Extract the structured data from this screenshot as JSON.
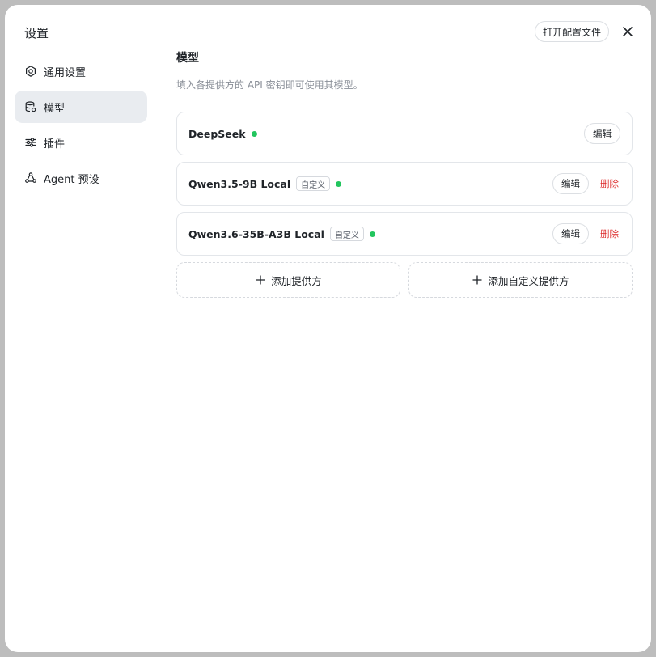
{
  "window": {
    "title": "设置",
    "open_config_label": "打开配置文件"
  },
  "sidebar": {
    "items": [
      {
        "label": "通用设置",
        "icon": "gear-icon",
        "active": false
      },
      {
        "label": "模型",
        "icon": "database-icon",
        "active": true
      },
      {
        "label": "插件",
        "icon": "sliders-icon",
        "active": false
      },
      {
        "label": "Agent 预设",
        "icon": "agent-icon",
        "active": false
      }
    ]
  },
  "main": {
    "title": "模型",
    "description": "填入各提供方的 API 密钥即可使用其模型。",
    "providers": [
      {
        "name": "DeepSeek",
        "custom": false,
        "edit_label": "编辑"
      },
      {
        "name": "Qwen3.5-9B Local",
        "custom": true,
        "badge": "自定义",
        "edit_label": "编辑",
        "delete_label": "删除"
      },
      {
        "name": "Qwen3.6-35B-A3B Local",
        "custom": true,
        "badge": "自定义",
        "edit_label": "编辑",
        "delete_label": "删除"
      }
    ],
    "add_provider_label": "添加提供方",
    "add_custom_provider_label": "添加自定义提供方"
  },
  "colors": {
    "status_ok": "#22c55e",
    "danger": "#dc2626",
    "active_nav_bg": "#e9ecf0"
  }
}
